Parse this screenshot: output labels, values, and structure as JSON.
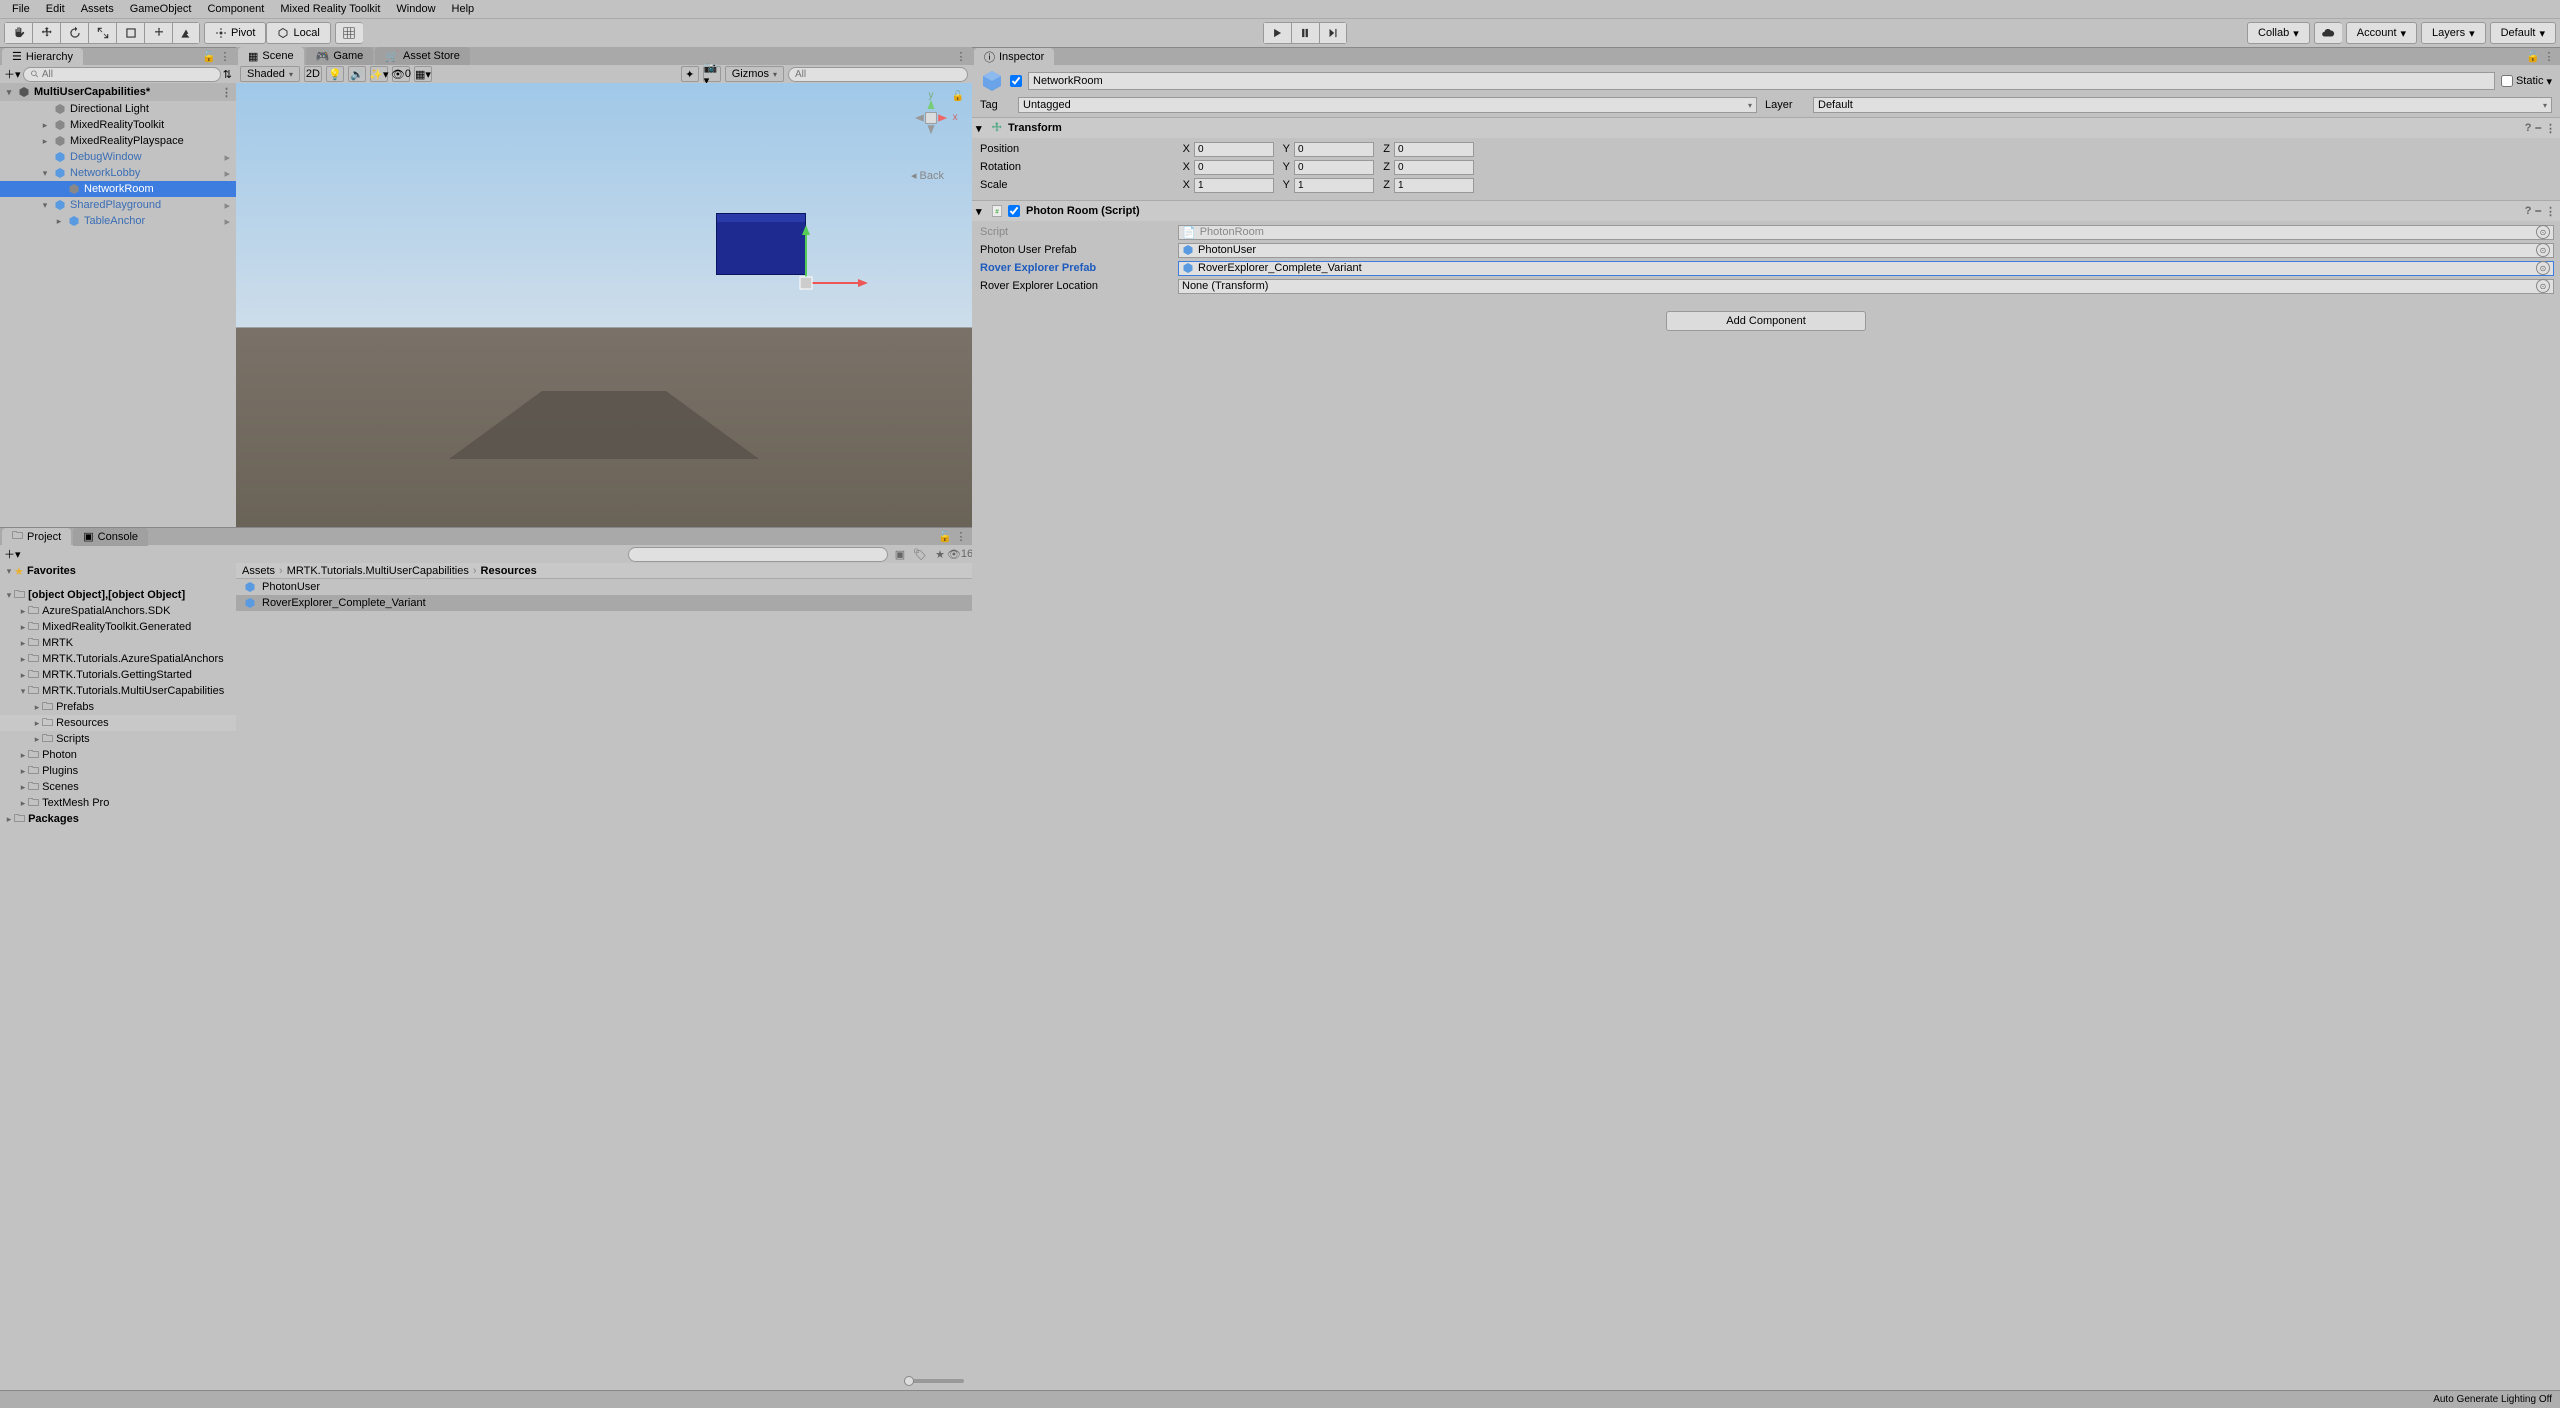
{
  "menu": [
    "File",
    "Edit",
    "Assets",
    "GameObject",
    "Component",
    "Mixed Reality Toolkit",
    "Window",
    "Help"
  ],
  "toolbar": {
    "pivot": "Pivot",
    "local": "Local",
    "collab": "Collab",
    "account": "Account",
    "layers": "Layers",
    "layout": "Default"
  },
  "hierarchy": {
    "title": "Hierarchy",
    "search_placeholder": "All",
    "scene": "MultiUserCapabilities*",
    "items": [
      {
        "name": "Directional Light",
        "depth": 1,
        "foldout": ""
      },
      {
        "name": "MixedRealityToolkit",
        "depth": 1,
        "foldout": "▸"
      },
      {
        "name": "MixedRealityPlayspace",
        "depth": 1,
        "foldout": "▸"
      },
      {
        "name": "DebugWindow",
        "depth": 1,
        "foldout": "",
        "prefab": true,
        "chev": true
      },
      {
        "name": "NetworkLobby",
        "depth": 1,
        "foldout": "▾",
        "prefab": true,
        "chev": true
      },
      {
        "name": "NetworkRoom",
        "depth": 2,
        "foldout": "",
        "selected": true
      },
      {
        "name": "SharedPlayground",
        "depth": 1,
        "foldout": "▾",
        "prefab": true,
        "chev": true
      },
      {
        "name": "TableAnchor",
        "depth": 2,
        "foldout": "▸",
        "prefab": true,
        "chev": true
      }
    ]
  },
  "scene_tabs": {
    "scene": "Scene",
    "game": "Game",
    "asset_store": "Asset Store"
  },
  "scene_toolbar": {
    "shading": "Shaded",
    "td": "2D",
    "extras_count": "0",
    "gizmos": "Gizmos",
    "search_placeholder": "All"
  },
  "scene_view": {
    "perspLabel": "",
    "back": "Back"
  },
  "project": {
    "title": "Project",
    "console": "Console",
    "favorites": "Favorites",
    "assets": [
      {
        "name": "PhotonUser"
      },
      {
        "name": "RoverExplorer_Complete_Variant",
        "selected": true
      }
    ],
    "packages": "Packages",
    "hidden_count": "16",
    "tree": [
      {
        "name": "AzureSpatialAnchors.SDK",
        "depth": 1
      },
      {
        "name": "MixedRealityToolkit.Generated",
        "depth": 1
      },
      {
        "name": "MRTK",
        "depth": 1
      },
      {
        "name": "MRTK.Tutorials.AzureSpatialAnchors",
        "depth": 1
      },
      {
        "name": "MRTK.Tutorials.GettingStarted",
        "depth": 1
      },
      {
        "name": "MRTK.Tutorials.MultiUserCapabilities",
        "depth": 1,
        "open": true
      },
      {
        "name": "Prefabs",
        "depth": 2
      },
      {
        "name": "Resources",
        "depth": 2,
        "selected": true
      },
      {
        "name": "Scripts",
        "depth": 2
      },
      {
        "name": "Photon",
        "depth": 1
      },
      {
        "name": "Plugins",
        "depth": 1
      },
      {
        "name": "Scenes",
        "depth": 1
      },
      {
        "name": "TextMesh Pro",
        "depth": 1
      }
    ],
    "breadcrumb": [
      "Assets",
      "MRTK.Tutorials.MultiUserCapabilities",
      "Resources"
    ]
  },
  "inspector": {
    "title": "Inspector",
    "go_name": "NetworkRoom",
    "static": "Static",
    "tag_label": "Tag",
    "tag_value": "Untagged",
    "layer_label": "Layer",
    "layer_value": "Default",
    "transform": {
      "title": "Transform",
      "position": "Position",
      "rotation": "Rotation",
      "scale": "Scale",
      "pos": {
        "x": "0",
        "y": "0",
        "z": "0"
      },
      "rot": {
        "x": "0",
        "y": "0",
        "z": "0"
      },
      "scl": {
        "x": "1",
        "y": "1",
        "z": "1"
      }
    },
    "photon": {
      "title": "Photon Room (Script)",
      "script_label": "Script",
      "script_value": "PhotonRoom",
      "user_prefab_label": "Photon User Prefab",
      "user_prefab_value": "PhotonUser",
      "rover_prefab_label": "Rover Explorer Prefab",
      "rover_prefab_value": "RoverExplorer_Complete_Variant",
      "rover_loc_label": "Rover Explorer Location",
      "rover_loc_value": "None (Transform)"
    },
    "add_component": "Add Component"
  },
  "status": {
    "right": "Auto Generate Lighting Off"
  }
}
